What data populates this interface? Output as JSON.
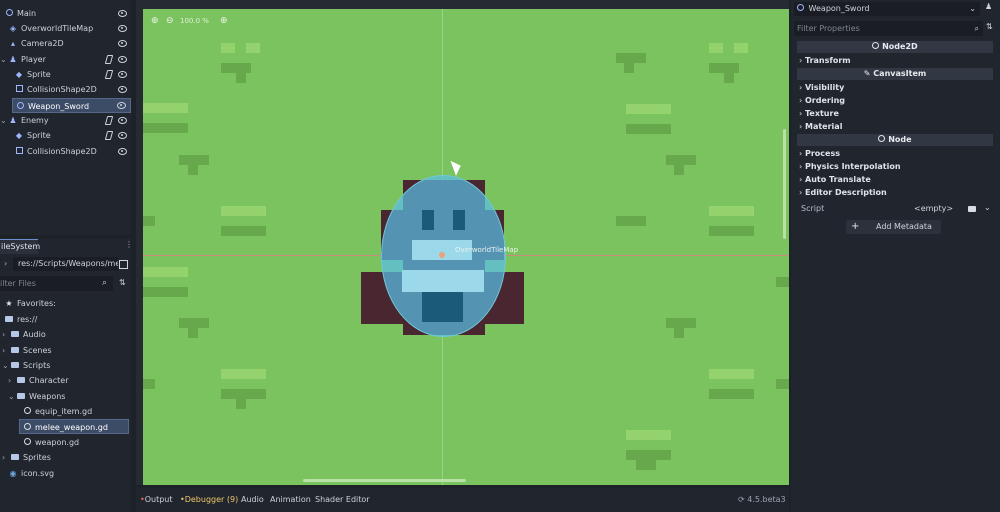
{
  "scene_tree": {
    "items": [
      {
        "label": "Main",
        "icon": "node-icon"
      },
      {
        "label": "OverworldTileMap",
        "icon": "tilemap-icon"
      },
      {
        "label": "Camera2D",
        "icon": "camera-icon"
      },
      {
        "label": "Player",
        "icon": "character-icon"
      },
      {
        "label": "Sprite",
        "icon": "sprite-icon"
      },
      {
        "label": "CollisionShape2D",
        "icon": "collision-icon"
      },
      {
        "label": "Weapon_Sword",
        "icon": "node-icon"
      },
      {
        "label": "Enemy",
        "icon": "character-icon"
      },
      {
        "label": "Sprite",
        "icon": "sprite-icon"
      },
      {
        "label": "CollisionShape2D",
        "icon": "collision-icon"
      }
    ]
  },
  "filesystem": {
    "tab_label": "ileSystem",
    "path": "res://Scripts/Weapons/me",
    "filter_placeholder": "ilter Files",
    "favorites_label": "Favorites:",
    "items": [
      {
        "label": "res://"
      },
      {
        "label": "Audio"
      },
      {
        "label": "Scenes"
      },
      {
        "label": "Scripts"
      },
      {
        "label": "Character"
      },
      {
        "label": "Weapons"
      },
      {
        "label": "equip_item.gd"
      },
      {
        "label": "melee_weapon.gd"
      },
      {
        "label": "weapon.gd"
      },
      {
        "label": "Sprites"
      },
      {
        "label": "icon.svg"
      }
    ]
  },
  "viewport": {
    "zoom_label": "100.0 %",
    "node_label": "OverworldTileMap"
  },
  "bottom_panel": {
    "tabs": [
      {
        "label": "Output"
      },
      {
        "label": "Debugger (9)"
      },
      {
        "label": "Audio"
      },
      {
        "label": "Animation"
      },
      {
        "label": "Shader Editor"
      }
    ],
    "version": "4.5.beta3"
  },
  "inspector": {
    "selected_node": "Weapon_Sword",
    "filter_placeholder": "Filter Properties",
    "headers": [
      {
        "label": "Node2D"
      },
      {
        "label": "CanvasItem"
      },
      {
        "label": "Node"
      }
    ],
    "sections": [
      {
        "label": "Transform"
      },
      {
        "label": "Visibility"
      },
      {
        "label": "Ordering"
      },
      {
        "label": "Texture"
      },
      {
        "label": "Material"
      },
      {
        "label": "Process"
      },
      {
        "label": "Physics Interpolation"
      },
      {
        "label": "Auto Translate"
      },
      {
        "label": "Editor Description"
      }
    ],
    "script_label": "Script",
    "script_value": "<empty>",
    "add_metadata": "Add Metadata"
  }
}
